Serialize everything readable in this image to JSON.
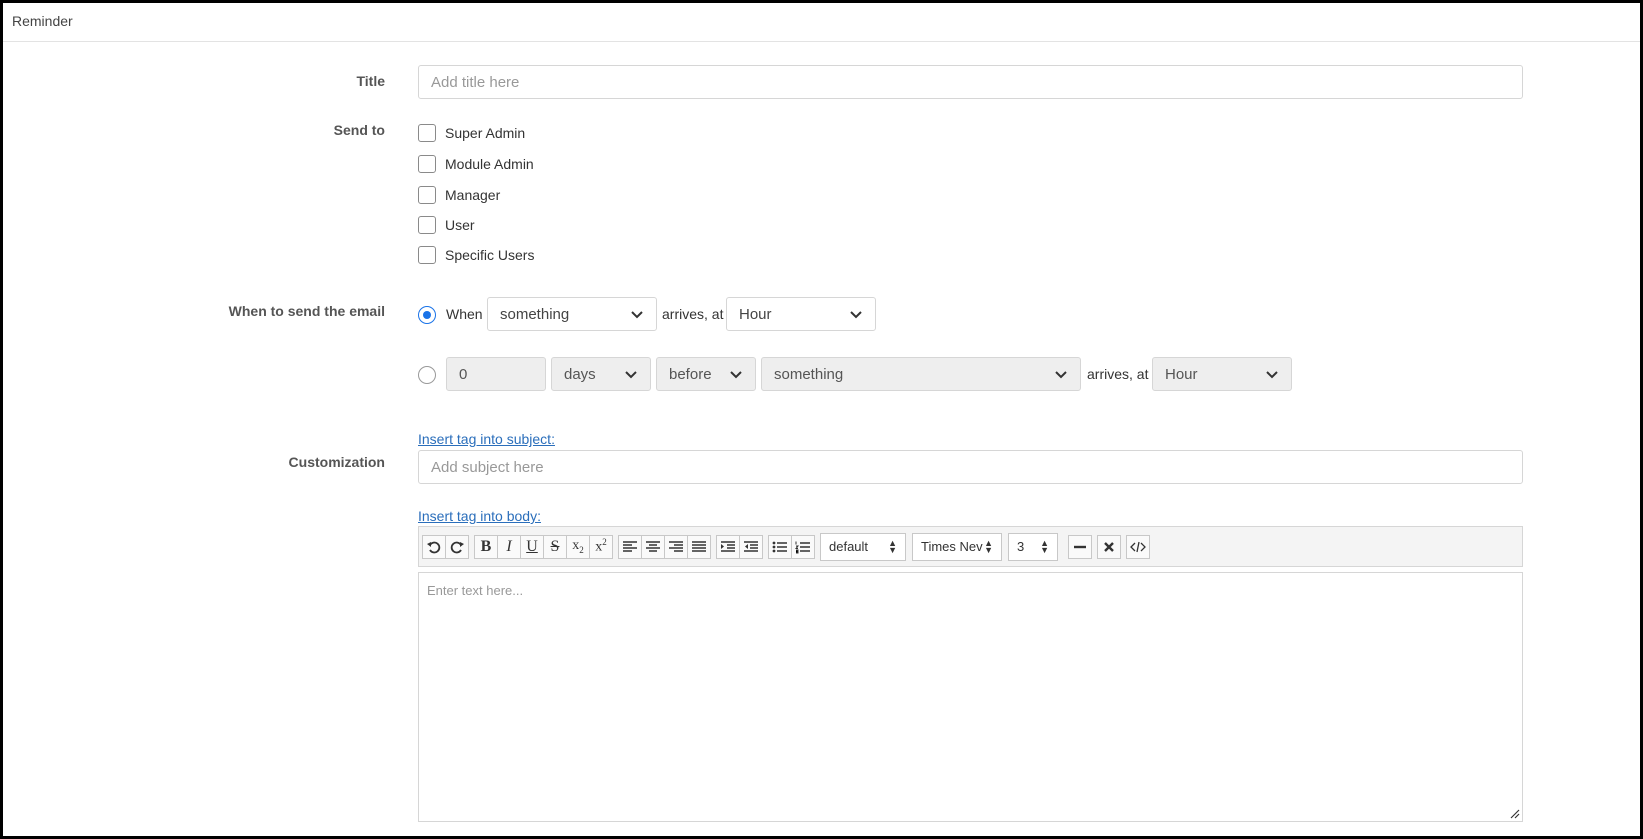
{
  "panel": {
    "title": "Reminder"
  },
  "form": {
    "title": {
      "label": "Title",
      "placeholder": "Add title here"
    },
    "send_to": {
      "label": "Send to",
      "options": [
        "Super Admin",
        "Module Admin",
        "Manager",
        "User",
        "Specific Users"
      ]
    },
    "when": {
      "label": "When to send the email",
      "option1": {
        "prefix": "When",
        "event": "something",
        "arrives_text": "arrives, at",
        "hour": "Hour"
      },
      "option2": {
        "amount": "0",
        "unit": "days",
        "relation": "before",
        "event": "something",
        "arrives_text": "arrives, at",
        "hour": "Hour"
      }
    },
    "customization": {
      "label": "Customization",
      "subject_link": "Insert tag into subject:",
      "subject_placeholder": "Add subject here",
      "body_link": "Insert tag into body:",
      "toolbar": {
        "style": "default",
        "font": "Times Nev",
        "size": "3"
      },
      "body_placeholder": "Enter text here..."
    }
  },
  "colors": {
    "accent": "#1a73e8",
    "link": "#2a6ebb",
    "border": "#d6d6d6"
  }
}
